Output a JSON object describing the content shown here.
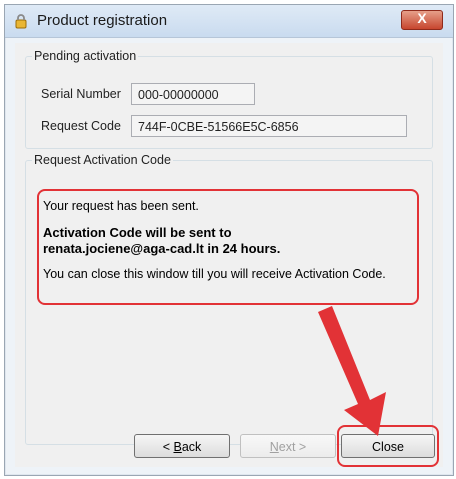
{
  "window": {
    "title": "Product registration",
    "close_symbol": "X"
  },
  "pending": {
    "legend": "Pending activation",
    "serial_label": "Serial Number",
    "serial_value": "000-00000000",
    "request_label": "Request Code",
    "request_value": "744F-0CBE-51566E5C-6856"
  },
  "request": {
    "legend": "Request Activation Code",
    "line1": "Your request has been sent.",
    "line2a": "Activation Code will be sent to",
    "line2b": "renata.jociene@aga-cad.lt in 24 hours.",
    "line3": "You can close this window till you will receive Activation Code."
  },
  "buttons": {
    "back_prefix": "< ",
    "back_mnemonic": "B",
    "back_rest": "ack",
    "next_mnemonic": "N",
    "next_rest": "ext >",
    "close": "Close"
  },
  "colors": {
    "annotation": "#e23236"
  },
  "icons": {
    "title_icon": "lock-icon",
    "annotation_arrow": "red-arrow-icon"
  }
}
